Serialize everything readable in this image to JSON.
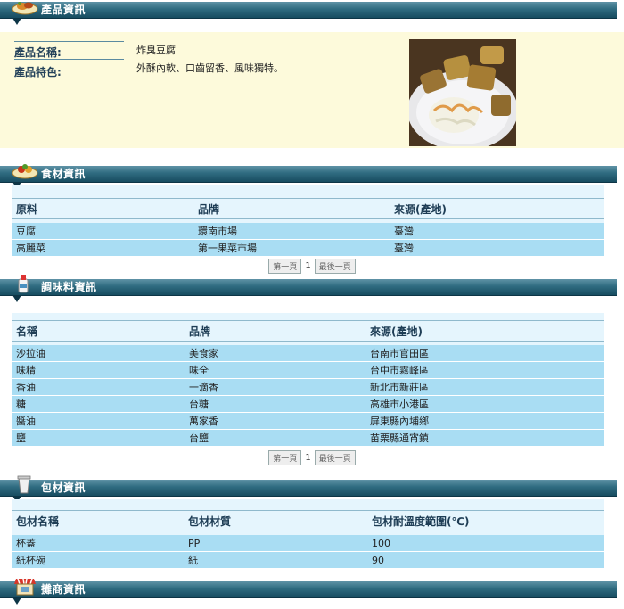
{
  "sections": {
    "product": "產品資訊",
    "ingredients": "食材資訊",
    "seasoning": "調味料資訊",
    "packaging": "包材資訊",
    "vendor": "攤商資訊"
  },
  "product": {
    "name_label": "產品名稱:",
    "feature_label": "產品特色:",
    "name": "炸臭豆腐",
    "feature": "外酥內軟、口齒留香、風味獨特。"
  },
  "ingredients": {
    "headers": [
      "原料",
      "品牌",
      "來源(產地)"
    ],
    "rows": [
      [
        "豆腐",
        "環南市場",
        "臺灣"
      ],
      [
        "高麗菜",
        "第一果菜市場",
        "臺灣"
      ]
    ]
  },
  "seasoning": {
    "headers": [
      "名稱",
      "品牌",
      "來源(產地)"
    ],
    "rows": [
      [
        "沙拉油",
        "美食家",
        "台南市官田區"
      ],
      [
        "味精",
        "味全",
        "台中市霧峰區"
      ],
      [
        "香油",
        "一滴香",
        "新北市新莊區"
      ],
      [
        "糖",
        "台糖",
        "高雄市小港區"
      ],
      [
        "醬油",
        "萬家香",
        "屏東縣內埔鄉"
      ],
      [
        "鹽",
        "台鹽",
        "苗栗縣通宵鎮"
      ]
    ]
  },
  "packaging": {
    "headers": [
      "包材名稱",
      "包材材質",
      "包材耐溫度範圍(℃)"
    ],
    "rows": [
      [
        "杯蓋",
        "PP",
        "100"
      ],
      [
        "紙杯碗",
        "紙",
        "90"
      ]
    ]
  },
  "pager": {
    "first": "第一頁",
    "page": "1",
    "last": "最後一頁"
  },
  "icons": {
    "product": "food-plate-icon",
    "ingredients": "vegetable-plate-icon",
    "seasoning": "seasoning-bottle-icon",
    "packaging": "cup-icon",
    "vendor": "stall-icon"
  }
}
